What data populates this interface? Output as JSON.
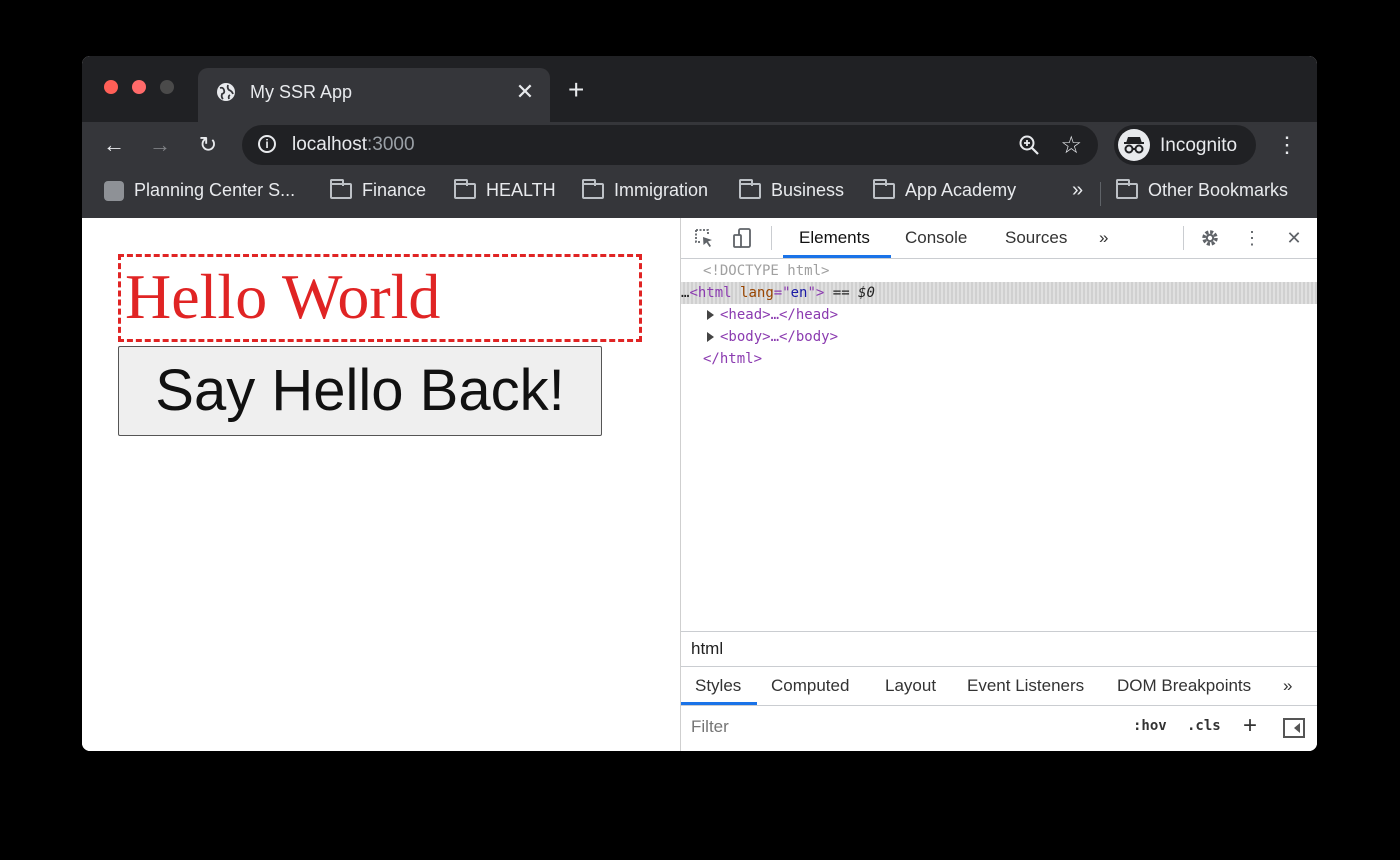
{
  "browser": {
    "tab_title": "My SSR App",
    "tab_close": "✕",
    "new_tab": "+",
    "url_host": "localhost",
    "url_port": ":3000",
    "profile_label": "Incognito",
    "menu": "⋮",
    "back": "←",
    "forward": "→",
    "reload": "↻",
    "star": "☆"
  },
  "bookmarks": [
    {
      "label": "Planning Center S...",
      "icon": "planning-center-icon"
    },
    {
      "label": "Finance",
      "icon": "folder-icon"
    },
    {
      "label": "HEALTH",
      "icon": "folder-icon"
    },
    {
      "label": "Immigration",
      "icon": "folder-icon"
    },
    {
      "label": "Business",
      "icon": "folder-icon"
    },
    {
      "label": "App Academy",
      "icon": "folder-icon"
    }
  ],
  "bookmarks_more": "»",
  "other_bookmarks": "Other Bookmarks",
  "page": {
    "heading": "Hello World",
    "button_label": "Say Hello Back!",
    "heading_color": "#e02424"
  },
  "devtools": {
    "tabs": [
      "Elements",
      "Console",
      "Sources"
    ],
    "tabs_more": "»",
    "active_tab": "Elements",
    "dom": {
      "doctype": "<!DOCTYPE html>",
      "html_tag_open": "<html",
      "html_attr": "lang",
      "html_attr_eq": "=\"",
      "html_attr_val": "en",
      "html_attr_end": "\">",
      "html_selected_marker": "== $0",
      "ellipsis_marker": "…",
      "head": "<head>…</head>",
      "body": "<body>…</body>",
      "html_close": "</html>"
    },
    "breadcrumb": "html",
    "styles_tabs": [
      "Styles",
      "Computed",
      "Layout",
      "Event Listeners",
      "DOM Breakpoints"
    ],
    "styles_tabs_more": "»",
    "filter_placeholder": "Filter",
    "hov": ":hov",
    "cls": ".cls",
    "add_rule": "+"
  }
}
